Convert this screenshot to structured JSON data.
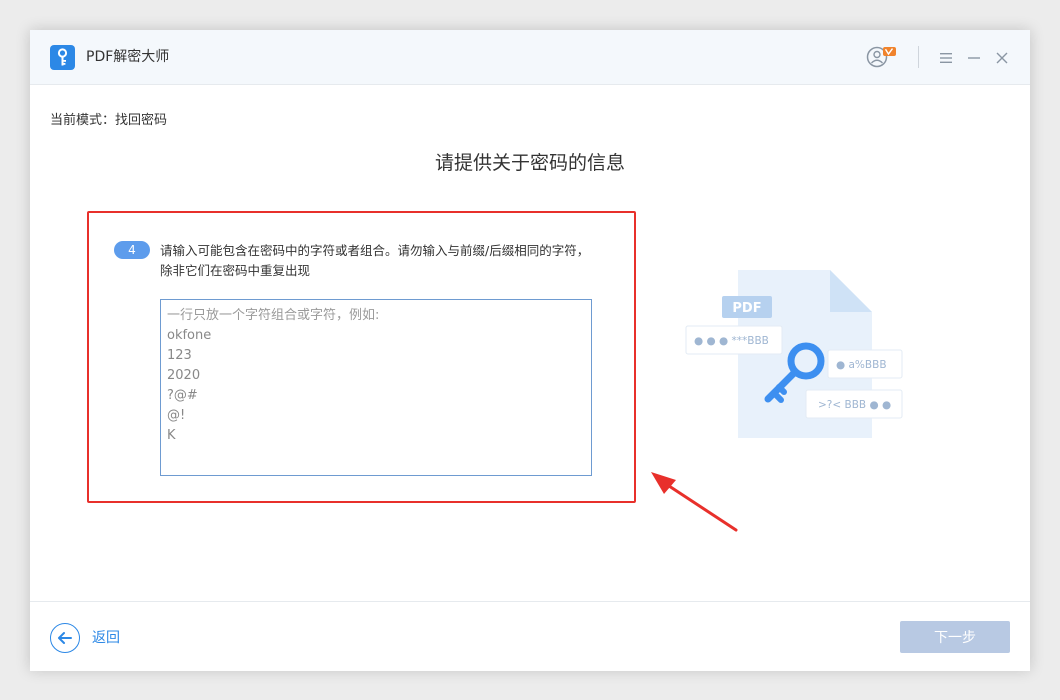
{
  "app": {
    "title": "PDF解密大师"
  },
  "mode": {
    "label": "当前模式：找回密码"
  },
  "page": {
    "title": "请提供关于密码的信息"
  },
  "step": {
    "number": "4",
    "instruction": "请输入可能包含在密码中的字符或者组合。请勿输入与前缀/后缀相同的字符，除非它们在密码中重复出现"
  },
  "chars_input": {
    "value": "",
    "placeholder_lines": [
      "一行只放一个字符组合或字符，例如:",
      "okfone",
      "123",
      "2020",
      "?@#",
      "@!",
      "K"
    ]
  },
  "illustration": {
    "doc_label": "PDF",
    "card1": "● ● ●  ***BBB",
    "card2": "●  a%BBB",
    "card3": ">?< BBB ● ●"
  },
  "footer": {
    "back_label": "返回",
    "next_label": "下一步"
  },
  "colors": {
    "accent": "#2c88e6",
    "highlight": "#e8302b",
    "badge": "#5d9cec",
    "next_disabled": "#b8c9e3"
  },
  "icons": [
    "key-logo-icon",
    "user-vip-icon",
    "menu-icon",
    "minimize-icon",
    "close-icon",
    "back-arrow-icon",
    "pdf-key-illustration",
    "red-arrow-annotation"
  ]
}
